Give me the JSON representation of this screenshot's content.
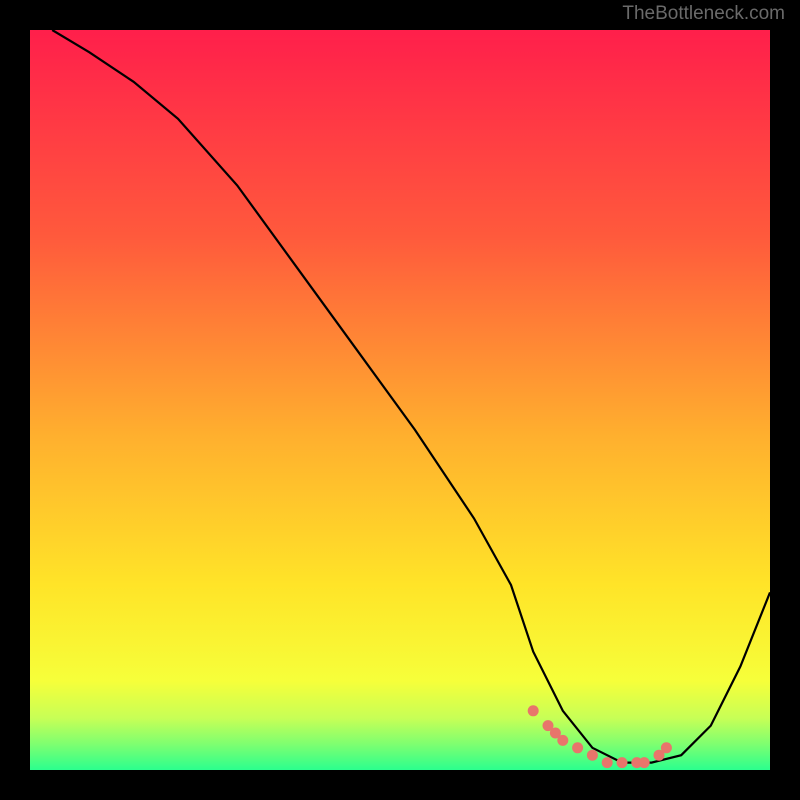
{
  "attribution": "TheBottleneck.com",
  "chart_data": {
    "type": "line",
    "title": "",
    "xlabel": "",
    "ylabel": "",
    "xlim": [
      0,
      100
    ],
    "ylim": [
      0,
      100
    ],
    "series": [
      {
        "name": "curve",
        "x": [
          3,
          8,
          14,
          20,
          28,
          36,
          44,
          52,
          60,
          65,
          68,
          72,
          76,
          80,
          84,
          88,
          92,
          96,
          100
        ],
        "values": [
          100,
          97,
          93,
          88,
          79,
          68,
          57,
          46,
          34,
          25,
          16,
          8,
          3,
          1,
          1,
          2,
          6,
          14,
          24
        ]
      }
    ],
    "markers": {
      "name": "highlight",
      "x": [
        68,
        70,
        71,
        72,
        74,
        76,
        78,
        80,
        82,
        83,
        85,
        86
      ],
      "values": [
        8,
        6,
        5,
        4,
        3,
        2,
        1,
        1,
        1,
        1,
        2,
        3
      ]
    },
    "gradient_stops": [
      {
        "pos": 0,
        "color": "#ff1f4b"
      },
      {
        "pos": 0.28,
        "color": "#ff5a3c"
      },
      {
        "pos": 0.55,
        "color": "#ffb02e"
      },
      {
        "pos": 0.75,
        "color": "#ffe428"
      },
      {
        "pos": 0.88,
        "color": "#f6ff3a"
      },
      {
        "pos": 0.93,
        "color": "#c7ff56"
      },
      {
        "pos": 0.965,
        "color": "#7eff70"
      },
      {
        "pos": 1.0,
        "color": "#2bff8e"
      }
    ]
  }
}
